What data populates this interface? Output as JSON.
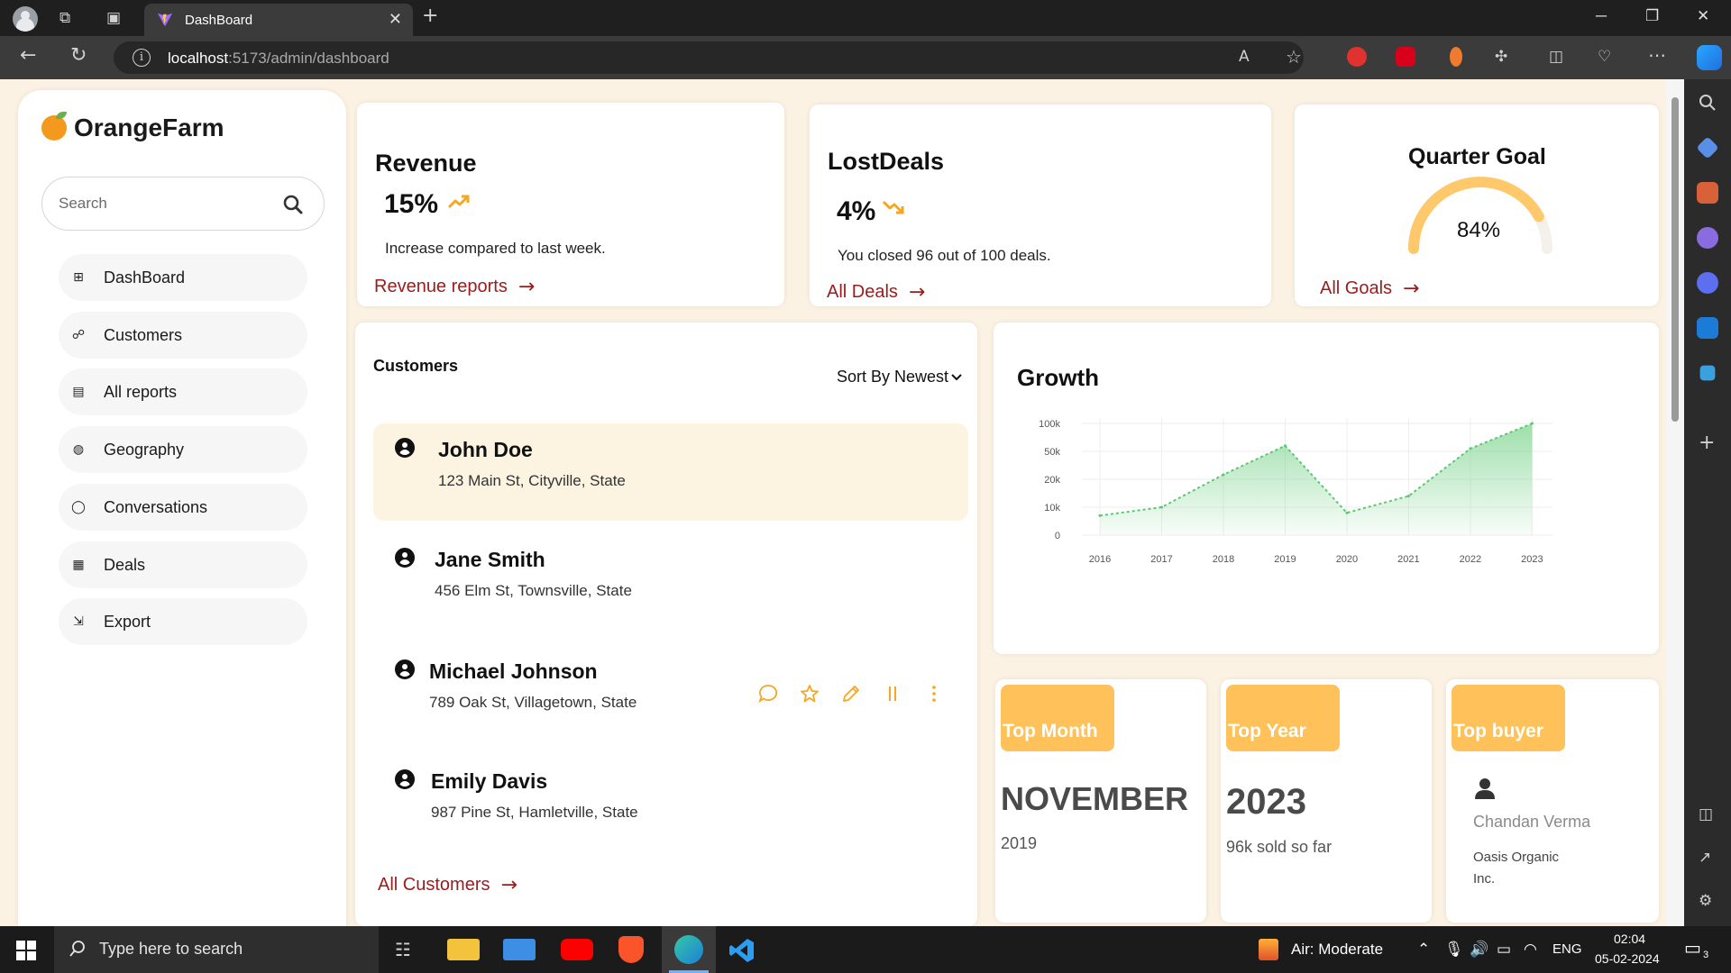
{
  "browser": {
    "tab_title": "DashBoard",
    "url_host": "localhost",
    "url_path": ":5173/admin/dashboard"
  },
  "app": {
    "brand": "OrangeFarm",
    "search_placeholder": "Search"
  },
  "sidebar": {
    "items": [
      {
        "label": "DashBoard",
        "icon": "grid-icon"
      },
      {
        "label": "Customers",
        "icon": "users-icon"
      },
      {
        "label": "All reports",
        "icon": "clipboard-icon"
      },
      {
        "label": "Geography",
        "icon": "globe-icon"
      },
      {
        "label": "Conversations",
        "icon": "chat-bubble-icon"
      },
      {
        "label": "Deals",
        "icon": "document-icon"
      },
      {
        "label": "Export",
        "icon": "export-icon"
      }
    ]
  },
  "revenue": {
    "title": "Revenue",
    "value": "15%",
    "description": "Increase compared to last week.",
    "link": "Revenue reports"
  },
  "lost_deals": {
    "title": "LostDeals",
    "value": "4%",
    "description": "You closed 96 out of 100 deals.",
    "link": "All Deals"
  },
  "quarter_goal": {
    "title": "Quarter Goal",
    "value": "84%",
    "progress": 0.84,
    "link": "All Goals"
  },
  "customers": {
    "title": "Customers",
    "sort_label": "Sort By Newest",
    "items": [
      {
        "name": "John Doe",
        "address": "123 Main St, Cityville, State"
      },
      {
        "name": "Jane Smith",
        "address": "456 Elm St, Townsville, State"
      },
      {
        "name": "Michael Johnson",
        "address": "789 Oak St, Villagetown, State"
      },
      {
        "name": "Emily Davis",
        "address": "987 Pine St, Hamletville, State"
      }
    ],
    "link": "All Customers"
  },
  "growth": {
    "title": "Growth"
  },
  "chart_data": {
    "type": "area",
    "title": "Growth",
    "x": [
      "2016",
      "2017",
      "2018",
      "2019",
      "2020",
      "2021",
      "2022",
      "2023"
    ],
    "y_ticks": [
      "0",
      "10k",
      "20k",
      "50k",
      "100k"
    ],
    "y_tick_values": [
      0,
      10000,
      20000,
      50000,
      100000
    ],
    "series": [
      {
        "values": [
          7000,
          10000,
          25000,
          60000,
          8000,
          14000,
          55000,
          100000
        ]
      }
    ],
    "color": "#7ed48f",
    "grid": true
  },
  "top_month": {
    "badge": "Top Month",
    "value": "NOVEMBER",
    "sub": "2019"
  },
  "top_year": {
    "badge": "Top Year",
    "value": "2023",
    "sub": "96k sold so far"
  },
  "top_buyer": {
    "badge": "Top buyer",
    "name": "Chandan Verma",
    "company": "Oasis Organic Inc."
  },
  "taskbar": {
    "search_placeholder": "Type here to search",
    "weather": "Air: Moderate",
    "language": "ENG",
    "time": "02:04",
    "date": "05-02-2024",
    "notifications": "3"
  },
  "colors": {
    "accent": "#ffc15a",
    "link": "#9b1c1c",
    "page_bg": "#fcf2e3",
    "chart_green": "#7ed48f"
  }
}
